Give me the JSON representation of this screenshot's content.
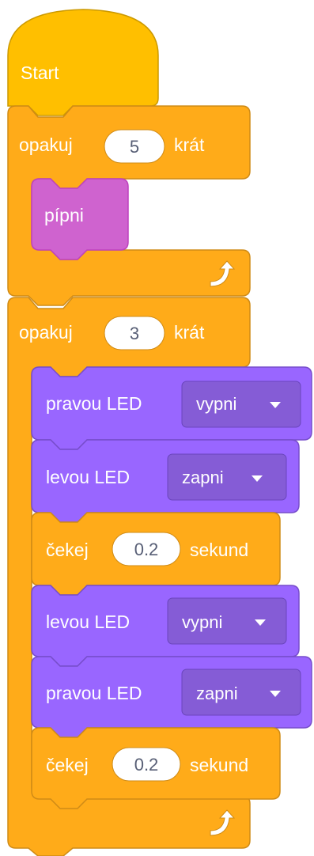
{
  "colors": {
    "hat": "#ffbf00",
    "control": "#ffab19",
    "control_stroke": "#cf8b17",
    "sound": "#cf63cf",
    "sound_stroke": "#bd42bd",
    "looks": "#9966ff",
    "looks_stroke": "#774dcb",
    "text": "#ffffff",
    "field_text": "#575e75"
  },
  "script": {
    "start": {
      "label": "Start"
    },
    "repeat1": {
      "prefix": "opakuj",
      "count": "5",
      "suffix": "krát",
      "loop_icon": "loop-arrow-icon"
    },
    "beep": {
      "label": "pípni"
    },
    "repeat2": {
      "prefix": "opakuj",
      "count": "3",
      "suffix": "krát",
      "loop_icon": "loop-arrow-icon"
    },
    "led1": {
      "label": "pravou LED",
      "value": "vypni",
      "dropdown_icon": "dropdown-arrow-icon"
    },
    "led2": {
      "label": "levou LED",
      "value": "zapni",
      "dropdown_icon": "dropdown-arrow-icon"
    },
    "wait1": {
      "prefix": "čekej",
      "seconds": "0.2",
      "suffix": "sekund"
    },
    "led3": {
      "label": "levou LED",
      "value": "vypni",
      "dropdown_icon": "dropdown-arrow-icon"
    },
    "led4": {
      "label": "pravou LED",
      "value": "zapni",
      "dropdown_icon": "dropdown-arrow-icon"
    },
    "wait2": {
      "prefix": "čekej",
      "seconds": "0.2",
      "suffix": "sekund"
    }
  }
}
